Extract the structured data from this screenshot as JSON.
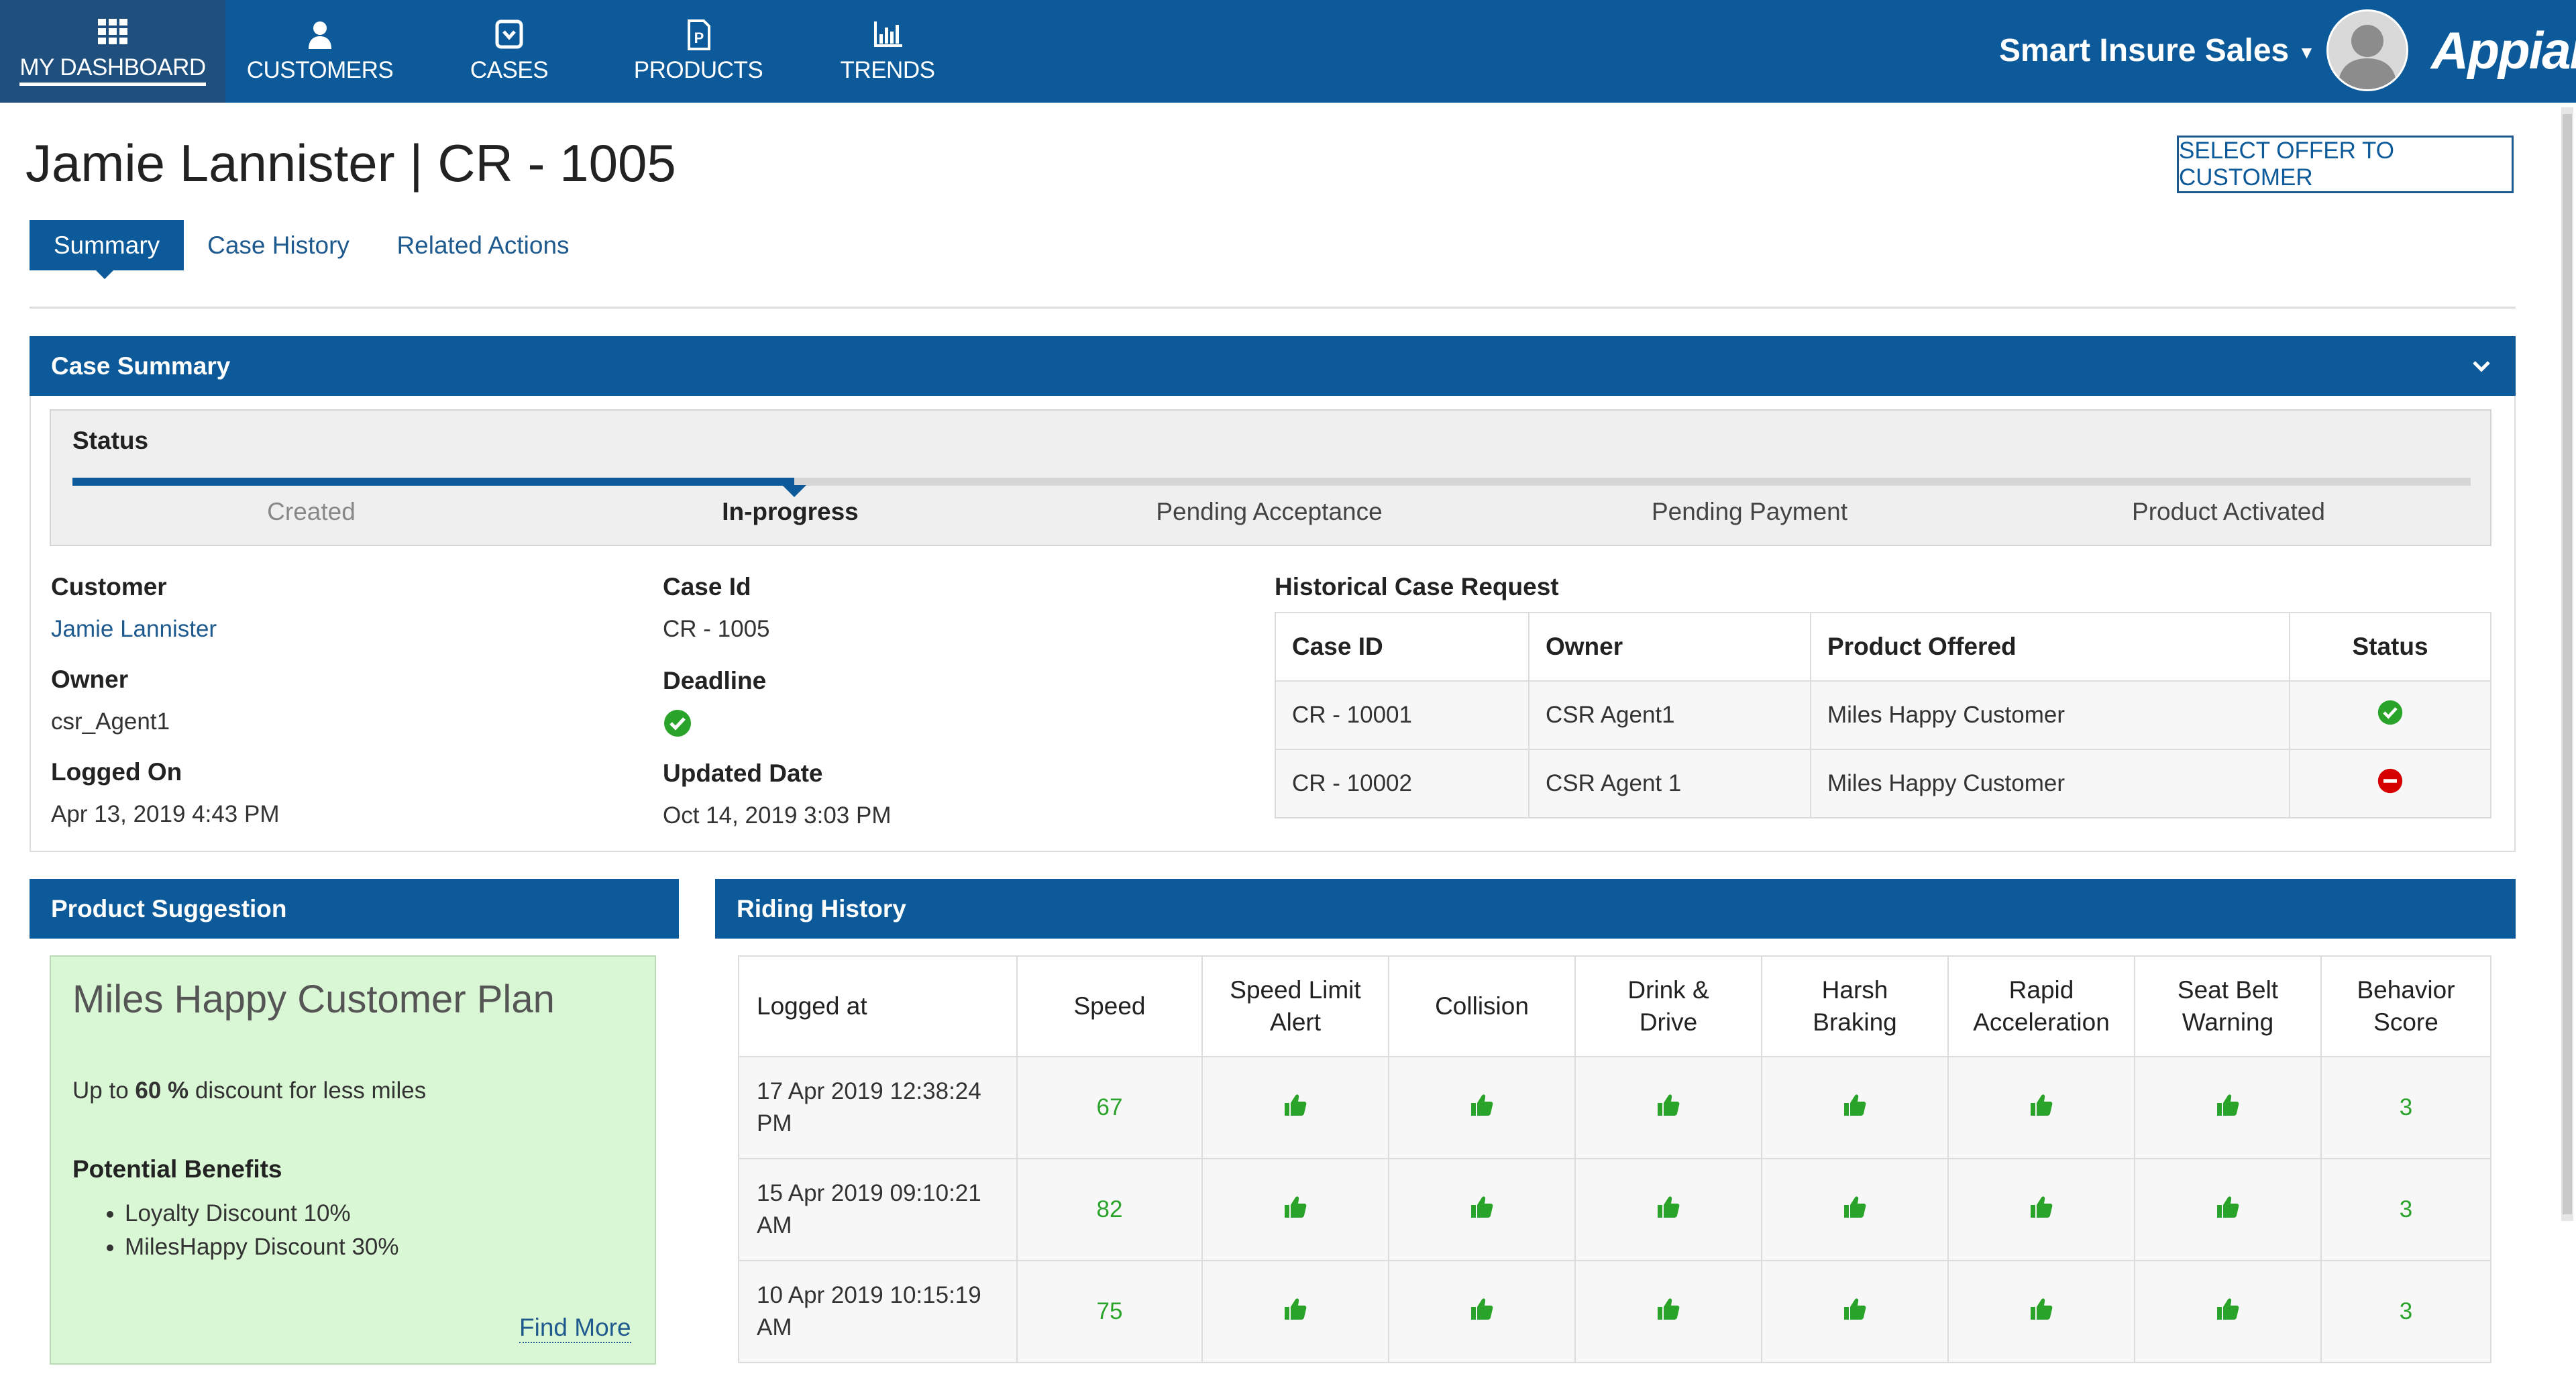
{
  "nav": {
    "items": [
      {
        "label": "MY DASHBOARD",
        "icon": "grid-icon"
      },
      {
        "label": "CUSTOMERS",
        "icon": "person-icon"
      },
      {
        "label": "CASES",
        "icon": "case-icon"
      },
      {
        "label": "PRODUCTS",
        "icon": "product-icon"
      },
      {
        "label": "TRENDS",
        "icon": "bar-chart-icon"
      }
    ],
    "app_name": "Smart Insure Sales",
    "logo": "Appian"
  },
  "colors": {
    "nav_bg": "#0c5a9a",
    "green": "#29a329",
    "red": "#d60000"
  },
  "page": {
    "title": "Jamie Lannister | CR - 1005",
    "select_offer": "SELECT OFFER TO CUSTOMER"
  },
  "tabs": [
    "Summary",
    "Case History",
    "Related Actions"
  ],
  "case_summary": {
    "header": "Case Summary",
    "status_title": "Status",
    "steps": [
      "Created",
      "In-progress",
      "Pending Acceptance",
      "Pending Payment",
      "Product Activated"
    ],
    "current_step": "In-progress",
    "customer_label": "Customer",
    "customer_value": "Jamie Lannister",
    "owner_label": "Owner",
    "owner_value": "csr_Agent1",
    "logged_on_label": "Logged On",
    "logged_on_value": "Apr 13, 2019 4:43 PM",
    "case_id_label": "Case Id",
    "case_id_value": "CR - 1005",
    "deadline_label": "Deadline",
    "updated_label": "Updated Date",
    "updated_value": "Oct 14, 2019 3:03 PM",
    "historical_title": "Historical Case Request",
    "historical_headers": [
      "Case ID",
      "Owner",
      "Product Offered",
      "Status"
    ],
    "historical_rows": [
      {
        "case_id": "CR - 10001",
        "owner": "CSR Agent1",
        "product": "Miles Happy Customer",
        "status": "check-circle-icon"
      },
      {
        "case_id": "CR - 10002",
        "owner": "CSR Agent 1",
        "product": "Miles Happy Customer",
        "status": "minus-circle-icon"
      }
    ]
  },
  "product_suggestion": {
    "header": "Product Suggestion",
    "plan": "Miles Happy Customer  Plan",
    "discount_prefix": "Up to",
    "discount_value": "60 %",
    "discount_suffix": "discount for less miles",
    "benefits_title": "Potential Benefits",
    "benefits": [
      "Loyalty Discount 10%",
      "MilesHappy Discount 30%"
    ],
    "find_more": "Find More"
  },
  "riding_history": {
    "header": "Riding History",
    "headers": [
      "Logged at",
      "Speed",
      "Speed Limit Alert",
      "Collision",
      "Drink & Drive",
      "Harsh Braking",
      "Rapid Acceleration",
      "Seat Belt Warning",
      "Behavior Score"
    ],
    "header_lines": [
      [
        "Logged at"
      ],
      [
        "Speed"
      ],
      [
        "Speed Limit",
        "Alert"
      ],
      [
        "Collision"
      ],
      [
        "Drink &",
        "Drive"
      ],
      [
        "Harsh",
        "Braking"
      ],
      [
        "Rapid",
        "Acceleration"
      ],
      [
        "Seat Belt",
        "Warning"
      ],
      [
        "Behavior",
        "Score"
      ]
    ],
    "rows": [
      {
        "logged_line1": "17 Apr 2019 12:38:24",
        "logged_line2": "PM",
        "speed": "67",
        "score": "3"
      },
      {
        "logged_line1": "15 Apr 2019 09:10:21",
        "logged_line2": "AM",
        "speed": "82",
        "score": "3"
      },
      {
        "logged_line1": "10 Apr 2019 10:15:19",
        "logged_line2": "AM",
        "speed": "75",
        "score": "3"
      }
    ],
    "flag_icon": "thumbs-up-icon"
  }
}
